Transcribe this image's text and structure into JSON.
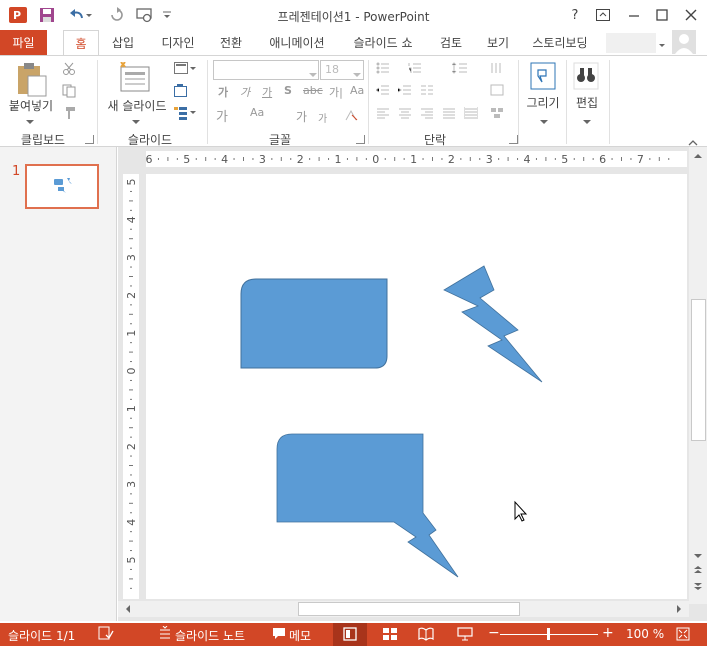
{
  "titlebar": {
    "title": "프레젠테이션1 - PowerPoint",
    "help": "?",
    "app_icon": "powerpoint-logo-icon"
  },
  "tabs": {
    "file": "파일",
    "items": [
      "홈",
      "삽입",
      "디자인",
      "전환",
      "애니메이션",
      "슬라이드 쇼",
      "검토",
      "보기",
      "스토리보딩"
    ],
    "active": "홈"
  },
  "ribbon": {
    "clipboard": {
      "label": "클립보드",
      "paste": "붙여넣기"
    },
    "slides": {
      "label": "슬라이드",
      "new_slide": "새 슬라이드"
    },
    "font": {
      "label": "글꼴",
      "font_name": "",
      "font_size": "18"
    },
    "paragraph": {
      "label": "단락"
    },
    "drawing": {
      "draw": "그리기"
    },
    "editing": {
      "edit": "편집"
    }
  },
  "thumbnails": {
    "slide_number": "1"
  },
  "rulers": {
    "horizontal_ticks": [
      "6",
      "5",
      "4",
      "3",
      "2",
      "1",
      "0",
      "1",
      "2",
      "3",
      "4",
      "5",
      "6",
      "7"
    ],
    "vertical_ticks": [
      "5",
      "4",
      "3",
      "2",
      "1",
      "0",
      "1",
      "2",
      "3",
      "4",
      "5"
    ]
  },
  "statusbar": {
    "slide_info": "슬라이드 1/1",
    "notes": "슬라이드 노트",
    "comments": "메모",
    "zoom": "100 %"
  },
  "colors": {
    "accent": "#D24726",
    "shape_fill": "#5B9BD5",
    "shape_stroke": "#41719C"
  }
}
